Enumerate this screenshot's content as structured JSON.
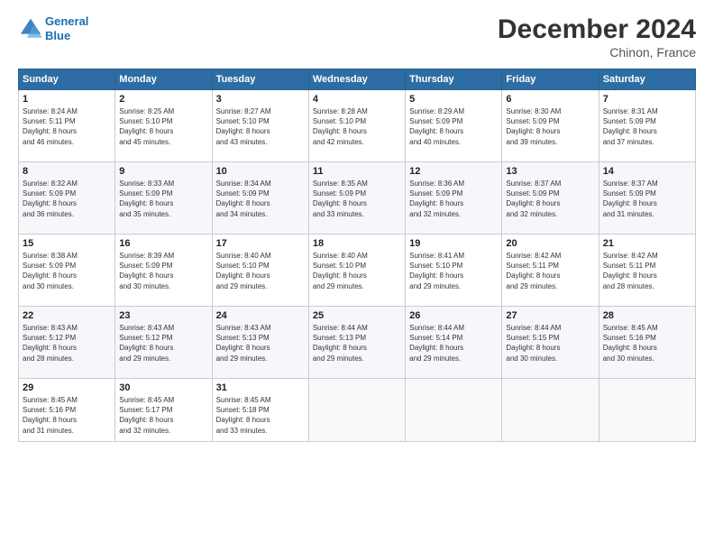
{
  "header": {
    "logo_line1": "General",
    "logo_line2": "Blue",
    "month": "December 2024",
    "location": "Chinon, France"
  },
  "days_of_week": [
    "Sunday",
    "Monday",
    "Tuesday",
    "Wednesday",
    "Thursday",
    "Friday",
    "Saturday"
  ],
  "weeks": [
    [
      {
        "day": "1",
        "info": "Sunrise: 8:24 AM\nSunset: 5:11 PM\nDaylight: 8 hours\nand 46 minutes."
      },
      {
        "day": "2",
        "info": "Sunrise: 8:25 AM\nSunset: 5:10 PM\nDaylight: 8 hours\nand 45 minutes."
      },
      {
        "day": "3",
        "info": "Sunrise: 8:27 AM\nSunset: 5:10 PM\nDaylight: 8 hours\nand 43 minutes."
      },
      {
        "day": "4",
        "info": "Sunrise: 8:28 AM\nSunset: 5:10 PM\nDaylight: 8 hours\nand 42 minutes."
      },
      {
        "day": "5",
        "info": "Sunrise: 8:29 AM\nSunset: 5:09 PM\nDaylight: 8 hours\nand 40 minutes."
      },
      {
        "day": "6",
        "info": "Sunrise: 8:30 AM\nSunset: 5:09 PM\nDaylight: 8 hours\nand 39 minutes."
      },
      {
        "day": "7",
        "info": "Sunrise: 8:31 AM\nSunset: 5:09 PM\nDaylight: 8 hours\nand 37 minutes."
      }
    ],
    [
      {
        "day": "8",
        "info": "Sunrise: 8:32 AM\nSunset: 5:09 PM\nDaylight: 8 hours\nand 36 minutes."
      },
      {
        "day": "9",
        "info": "Sunrise: 8:33 AM\nSunset: 5:09 PM\nDaylight: 8 hours\nand 35 minutes."
      },
      {
        "day": "10",
        "info": "Sunrise: 8:34 AM\nSunset: 5:09 PM\nDaylight: 8 hours\nand 34 minutes."
      },
      {
        "day": "11",
        "info": "Sunrise: 8:35 AM\nSunset: 5:09 PM\nDaylight: 8 hours\nand 33 minutes."
      },
      {
        "day": "12",
        "info": "Sunrise: 8:36 AM\nSunset: 5:09 PM\nDaylight: 8 hours\nand 32 minutes."
      },
      {
        "day": "13",
        "info": "Sunrise: 8:37 AM\nSunset: 5:09 PM\nDaylight: 8 hours\nand 32 minutes."
      },
      {
        "day": "14",
        "info": "Sunrise: 8:37 AM\nSunset: 5:09 PM\nDaylight: 8 hours\nand 31 minutes."
      }
    ],
    [
      {
        "day": "15",
        "info": "Sunrise: 8:38 AM\nSunset: 5:09 PM\nDaylight: 8 hours\nand 30 minutes."
      },
      {
        "day": "16",
        "info": "Sunrise: 8:39 AM\nSunset: 5:09 PM\nDaylight: 8 hours\nand 30 minutes."
      },
      {
        "day": "17",
        "info": "Sunrise: 8:40 AM\nSunset: 5:10 PM\nDaylight: 8 hours\nand 29 minutes."
      },
      {
        "day": "18",
        "info": "Sunrise: 8:40 AM\nSunset: 5:10 PM\nDaylight: 8 hours\nand 29 minutes."
      },
      {
        "day": "19",
        "info": "Sunrise: 8:41 AM\nSunset: 5:10 PM\nDaylight: 8 hours\nand 29 minutes."
      },
      {
        "day": "20",
        "info": "Sunrise: 8:42 AM\nSunset: 5:11 PM\nDaylight: 8 hours\nand 29 minutes."
      },
      {
        "day": "21",
        "info": "Sunrise: 8:42 AM\nSunset: 5:11 PM\nDaylight: 8 hours\nand 28 minutes."
      }
    ],
    [
      {
        "day": "22",
        "info": "Sunrise: 8:43 AM\nSunset: 5:12 PM\nDaylight: 8 hours\nand 28 minutes."
      },
      {
        "day": "23",
        "info": "Sunrise: 8:43 AM\nSunset: 5:12 PM\nDaylight: 8 hours\nand 29 minutes."
      },
      {
        "day": "24",
        "info": "Sunrise: 8:43 AM\nSunset: 5:13 PM\nDaylight: 8 hours\nand 29 minutes."
      },
      {
        "day": "25",
        "info": "Sunrise: 8:44 AM\nSunset: 5:13 PM\nDaylight: 8 hours\nand 29 minutes."
      },
      {
        "day": "26",
        "info": "Sunrise: 8:44 AM\nSunset: 5:14 PM\nDaylight: 8 hours\nand 29 minutes."
      },
      {
        "day": "27",
        "info": "Sunrise: 8:44 AM\nSunset: 5:15 PM\nDaylight: 8 hours\nand 30 minutes."
      },
      {
        "day": "28",
        "info": "Sunrise: 8:45 AM\nSunset: 5:16 PM\nDaylight: 8 hours\nand 30 minutes."
      }
    ],
    [
      {
        "day": "29",
        "info": "Sunrise: 8:45 AM\nSunset: 5:16 PM\nDaylight: 8 hours\nand 31 minutes."
      },
      {
        "day": "30",
        "info": "Sunrise: 8:45 AM\nSunset: 5:17 PM\nDaylight: 8 hours\nand 32 minutes."
      },
      {
        "day": "31",
        "info": "Sunrise: 8:45 AM\nSunset: 5:18 PM\nDaylight: 8 hours\nand 33 minutes."
      },
      {
        "day": "",
        "info": ""
      },
      {
        "day": "",
        "info": ""
      },
      {
        "day": "",
        "info": ""
      },
      {
        "day": "",
        "info": ""
      }
    ]
  ]
}
